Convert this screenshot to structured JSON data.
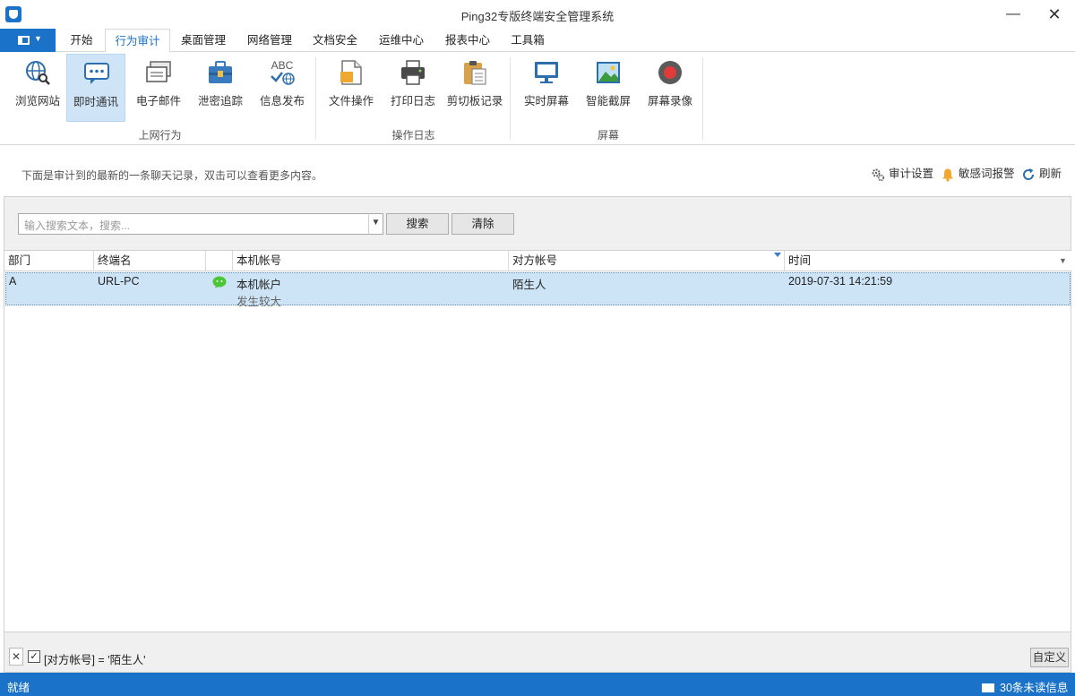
{
  "window": {
    "title": "Ping32专版终端安全管理系统",
    "minimize": "—",
    "close": "✕"
  },
  "menu": {
    "tabs": [
      "开始",
      "行为审计",
      "桌面管理",
      "网络管理",
      "文档安全",
      "运维中心",
      "报表中心",
      "工具箱"
    ],
    "active_tab": "行为审计"
  },
  "ribbon": {
    "groups": [
      {
        "label": "上网行为",
        "buttons": [
          "浏览网站",
          "即时通讯",
          "电子邮件",
          "泄密追踪",
          "信息发布"
        ]
      },
      {
        "label": "操作日志",
        "buttons": [
          "文件操作",
          "打印日志",
          "剪切板记录"
        ]
      },
      {
        "label": "屏幕",
        "buttons": [
          "实时屏幕",
          "智能截屏",
          "屏幕录像"
        ]
      }
    ],
    "selected_button": "即时通讯",
    "abc_icon_text": "ABC"
  },
  "info": {
    "text": "下面是审计到的最新的一条聊天记录，双击可以查看更多内容。",
    "audit_settings": "审计设置",
    "sensitive_alarm": "敏感词报警",
    "refresh": "刷新"
  },
  "search": {
    "placeholder": "输入搜索文本，搜索...",
    "search_button": "搜索",
    "clear_button": "清除"
  },
  "grid": {
    "columns": [
      "部门",
      "终端名",
      "",
      "本机帐号",
      "对方帐号",
      "时间"
    ],
    "rows": [
      {
        "department": "A",
        "terminal": "URL-PC",
        "icon": "wechat-icon",
        "local_account": "本机帐户",
        "remote_account": "陌生人",
        "time": "2019-07-31 14:21:59",
        "preview": "发生较大"
      }
    ]
  },
  "filter": {
    "text": "[对方帐号] = '陌生人'",
    "custom_button": "自定义"
  },
  "status": {
    "left": "就绪",
    "right": "30条未读信息"
  },
  "colors": {
    "accent": "#1a73c9",
    "selected_row": "#cde4f6",
    "wechat_green": "#4bc636"
  }
}
